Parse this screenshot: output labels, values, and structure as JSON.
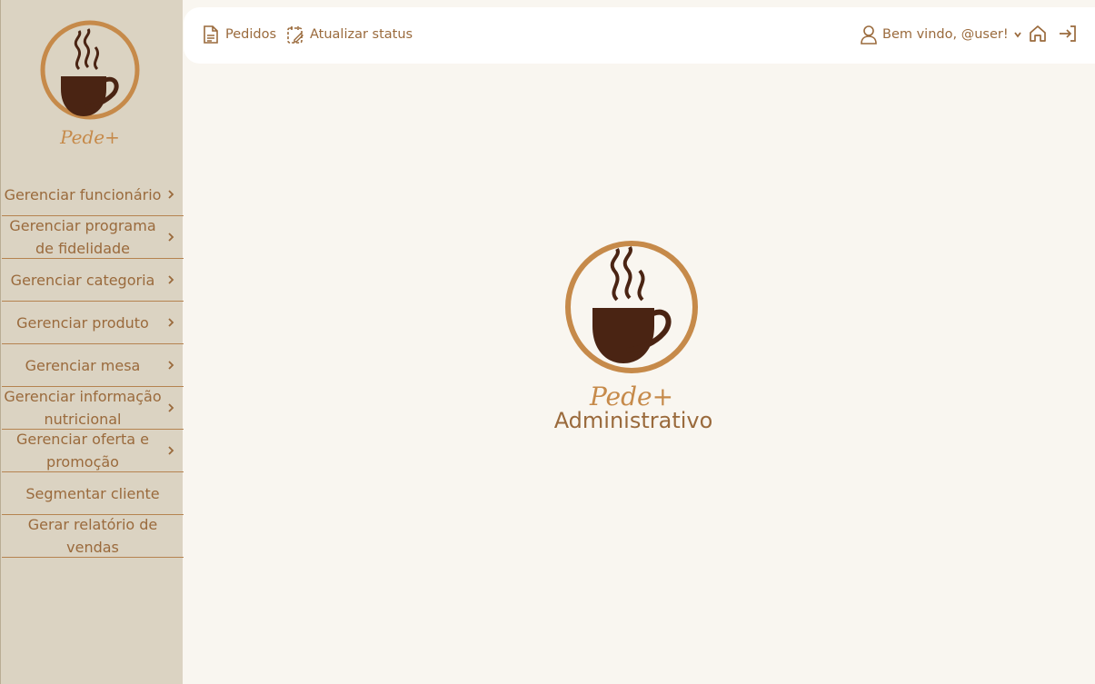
{
  "brand": {
    "name": "Pede+",
    "subtitle": "Administrativo"
  },
  "sidebar": {
    "items": [
      {
        "label": "Gerenciar funcionário",
        "has_chevron": true
      },
      {
        "label": "Gerenciar programa de fidelidade",
        "has_chevron": true
      },
      {
        "label": "Gerenciar categoria",
        "has_chevron": true
      },
      {
        "label": "Gerenciar produto",
        "has_chevron": true
      },
      {
        "label": "Gerenciar mesa",
        "has_chevron": true
      },
      {
        "label": "Gerenciar informação nutricional",
        "has_chevron": true
      },
      {
        "label": "Gerenciar oferta e promoção",
        "has_chevron": true
      },
      {
        "label": "Segmentar cliente",
        "has_chevron": false
      },
      {
        "label": "Gerar relatório de vendas",
        "has_chevron": false
      }
    ]
  },
  "topbar": {
    "orders_label": "Pedidos",
    "orders_icon": "document-icon",
    "status_label": "Atualizar status",
    "status_icon": "calendar-edit-icon",
    "user_label": "Bem vindo, @user!",
    "user_icon": "user-icon",
    "home_icon": "home-icon",
    "logout_icon": "logout-icon"
  },
  "colors": {
    "sidebar_bg": "#dbd3c2",
    "page_bg": "#f9f6f0",
    "accent": "#9a6a3c",
    "logo_ring": "#c68a4a",
    "cup": "#4a2413"
  }
}
